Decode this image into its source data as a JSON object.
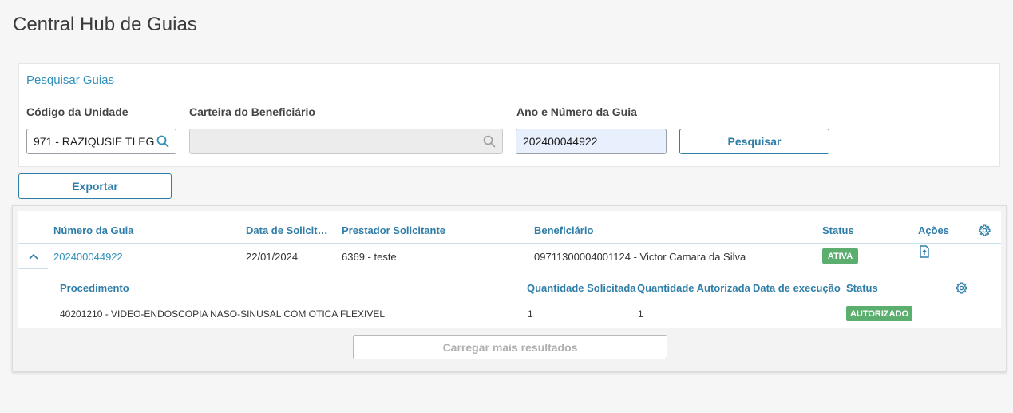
{
  "page": {
    "title": "Central Hub de Guias"
  },
  "search": {
    "title": "Pesquisar Guias",
    "unit_label": "Código da Unidade",
    "unit_value": "971 - RAZIQUSIE TI EG",
    "beneficiary_label": "Carteira do Beneficiário",
    "beneficiary_value": "",
    "guide_label": "Ano e Número da Guia",
    "guide_value": "202400044922",
    "search_button": "Pesquisar"
  },
  "toolbar": {
    "export_button": "Exportar"
  },
  "table": {
    "columns": {
      "numero": "Número da Guia",
      "data": "Data de Solicitação",
      "prestador": "Prestador Solicitante",
      "beneficiario": "Beneficiário",
      "status": "Status",
      "acoes": "Ações"
    },
    "rows": [
      {
        "numero": "202400044922",
        "data": "22/01/2024",
        "prestador": "6369 - teste",
        "beneficiario": "09711300004001124 - Victor Camara da Silva",
        "status": "ATIVA",
        "detail": {
          "columns": {
            "procedimento": "Procedimento",
            "qtd_solicitada": "Quantidade Solicitada",
            "qtd_autorizada": "Quantidade Autorizada",
            "data_execucao": "Data de execução",
            "status": "Status"
          },
          "rows": [
            {
              "procedimento": "40201210 - VIDEO-ENDOSCOPIA NASO-SINUSAL COM OTICA FLEXIVEL",
              "qtd_solicitada": "1",
              "qtd_autorizada": "1",
              "data_execucao": "",
              "status": "AUTORIZADO"
            }
          ]
        }
      }
    ],
    "load_more_button": "Carregar mais resultados"
  },
  "colors": {
    "accent": "#2f7ea8",
    "link": "#2f8fb8",
    "status_green": "#5cae6e"
  },
  "icons": {
    "unit_search": "search-icon",
    "beneficiary_search": "search-icon",
    "expand": "chevron-up-icon",
    "action": "document-upload-icon",
    "settings": "gear-icon"
  }
}
